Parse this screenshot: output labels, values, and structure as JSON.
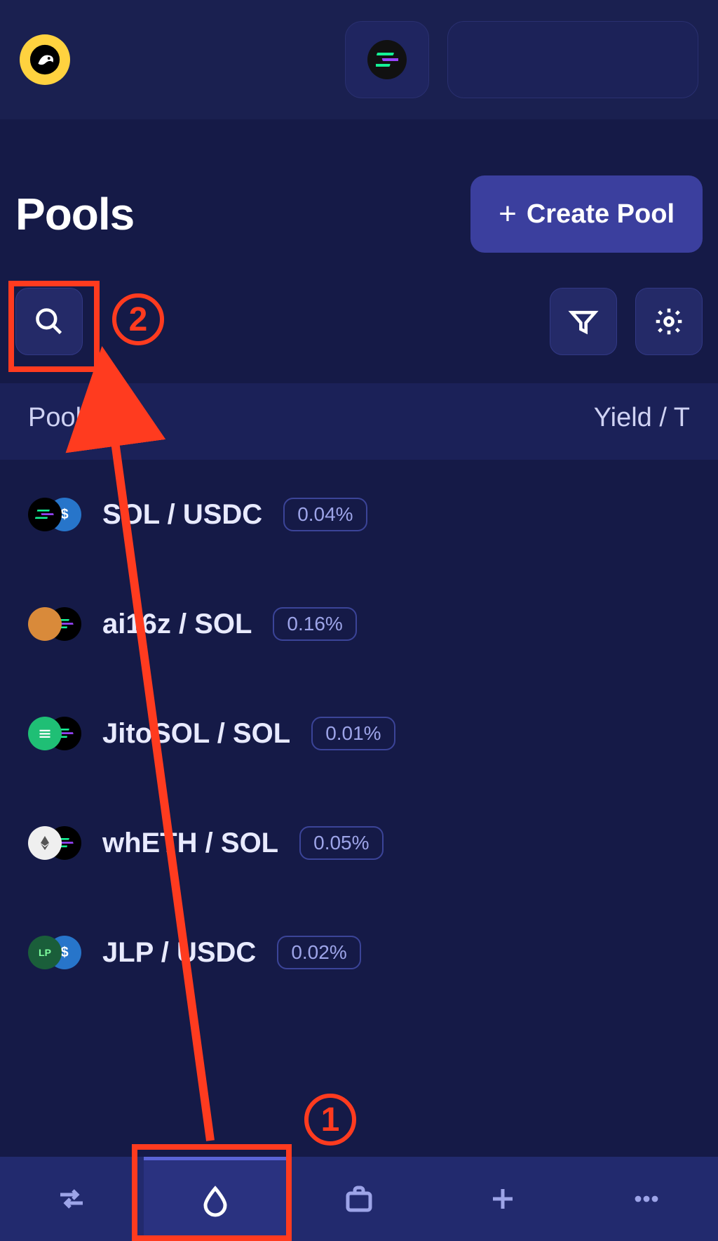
{
  "header": {
    "title": "Pools",
    "create_button_label": "Create Pool"
  },
  "columns": {
    "pool": "Pool",
    "yield": "Yield / T"
  },
  "pools": [
    {
      "pair": "SOL / USDC",
      "fee": "0.04%",
      "color_a": "#000000",
      "color_b": "#2775ca"
    },
    {
      "pair": "ai16z / SOL",
      "fee": "0.16%",
      "color_a": "#d98a3a",
      "color_b": "#000000"
    },
    {
      "pair": "JitoSOL / SOL",
      "fee": "0.01%",
      "color_a": "#1fbf75",
      "color_b": "#000000"
    },
    {
      "pair": "whETH / SOL",
      "fee": "0.05%",
      "color_a": "#e8e8e8",
      "color_b": "#000000"
    },
    {
      "pair": "JLP / USDC",
      "fee": "0.02%",
      "color_a": "#1a5e3a",
      "color_b": "#2775ca"
    }
  ],
  "annotations": {
    "step1": "1",
    "step2": "2"
  },
  "icons": {
    "search": "search-icon",
    "filter": "filter-icon",
    "settings": "gear-icon",
    "swap": "swap-icon",
    "pools": "drop-icon",
    "portfolio": "briefcase-icon",
    "add": "plus-icon",
    "more": "more-icon"
  }
}
